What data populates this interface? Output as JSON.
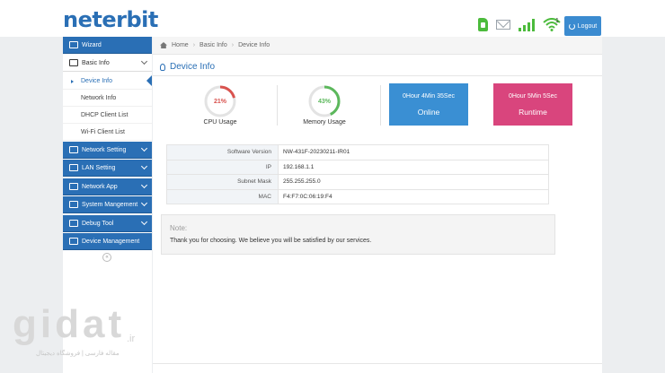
{
  "header": {
    "logo": "neterbit",
    "wifi_badge": "1",
    "logout_label": "Logout"
  },
  "icons": {
    "sim": "sim-card-icon",
    "mail": "mail-icon",
    "signal": "signal-bars-icon",
    "wifi": "wifi-icon",
    "logout": "power-icon"
  },
  "colors": {
    "brand": "#2a6fb5",
    "online_card": "#3a8fd3",
    "runtime_card": "#d9457d",
    "cpu_ring": "#d9534f",
    "memory_ring": "#5cb85c",
    "status_green": "#4cbb3c"
  },
  "sidebar": {
    "items": [
      {
        "label": "Wizard",
        "icon": "wizard-icon"
      },
      {
        "label": "Basic Info",
        "icon": "list-icon",
        "expanded": true
      },
      {
        "label": "Network Setting",
        "icon": "network-icon"
      },
      {
        "label": "LAN Setting",
        "icon": "monitor-icon"
      },
      {
        "label": "Network App",
        "icon": "app-icon"
      },
      {
        "label": "System Mangement",
        "icon": "system-icon"
      },
      {
        "label": "Debug Tool",
        "icon": "debug-icon"
      },
      {
        "label": "Device Management",
        "icon": "device-icon"
      }
    ],
    "sub_items": [
      "Device Info",
      "Network Info",
      "DHCP Client List",
      "Wi-Fi Client List"
    ]
  },
  "breadcrumb": [
    "Home",
    "Basic Info",
    "Device Info"
  ],
  "page_title": "Device Info",
  "gauges": {
    "cpu": {
      "value": "21%",
      "fraction": 0.21,
      "label": "CPU Usage"
    },
    "memory": {
      "value": "43%",
      "fraction": 0.43,
      "label": "Memory Usage"
    }
  },
  "cards": {
    "online": {
      "value": "0Hour 4Min 35Sec",
      "label": "Online"
    },
    "runtime": {
      "value": "0Hour 5Min 5Sec",
      "label": "Runtime"
    }
  },
  "device_info": [
    {
      "key": "Software Version",
      "value": "NW-431F-20230211-IR01"
    },
    {
      "key": "IP",
      "value": "192.168.1.1"
    },
    {
      "key": "Subnet Mask",
      "value": "255.255.255.0"
    },
    {
      "key": "MAC",
      "value": "F4:F7:0C:06:19:F4"
    }
  ],
  "note": {
    "title": "Note:",
    "text": "Thank you for choosing. We believe you will be satisfied by our services."
  },
  "watermark": {
    "brand": "gidat",
    "tld": ".ir",
    "subtitle": "مقاله فارسی | فروشگاه دیجیتال"
  }
}
